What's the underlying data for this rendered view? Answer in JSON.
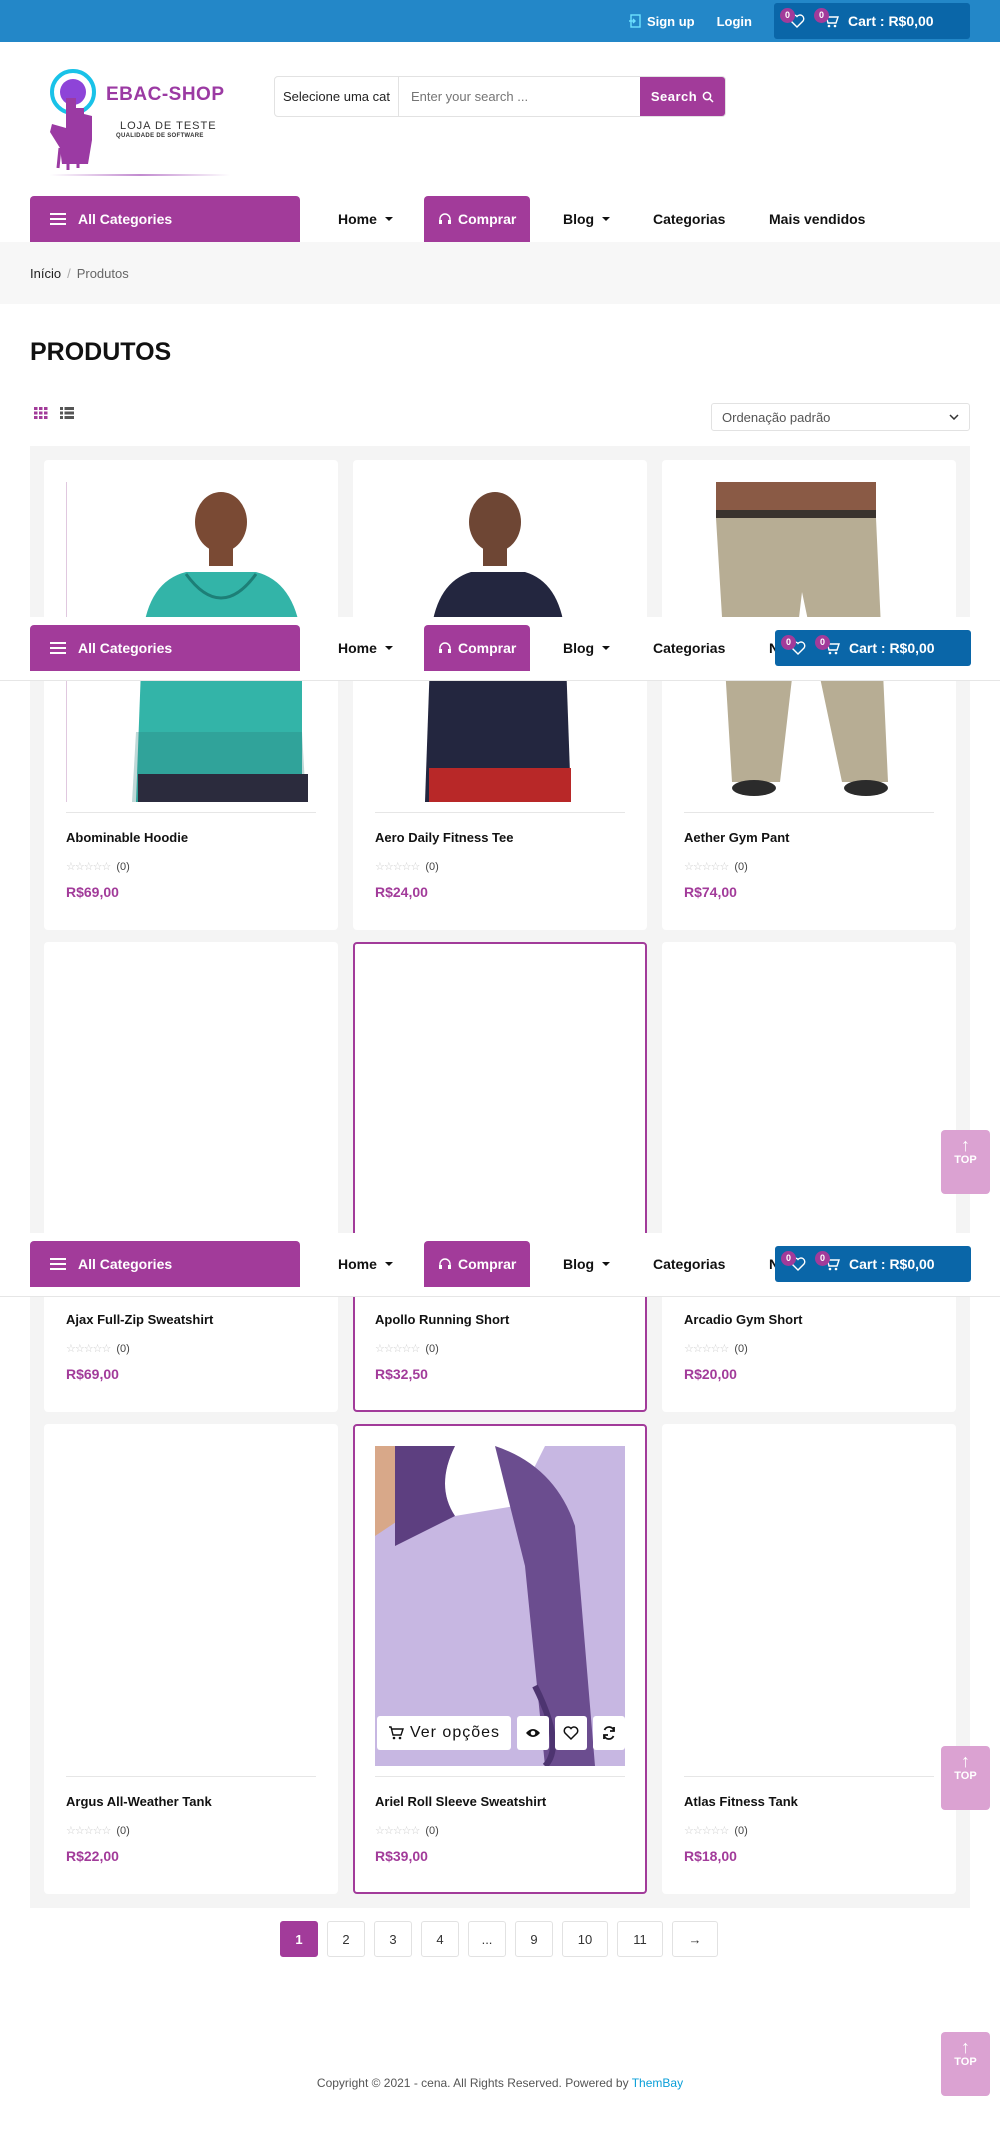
{
  "topbar": {
    "signup": "Sign up",
    "login": "Login",
    "wishlist_count": "0",
    "cart_count": "0",
    "cart_label": "Cart : R$0,00"
  },
  "logo": {
    "name": "EBAC-SHOP",
    "tagline": "LOJA DE TESTE",
    "tagline2": "QUALIDADE DE SOFTWARE"
  },
  "search": {
    "category": "Selecione uma cat",
    "placeholder": "Enter your search ...",
    "button": "Search"
  },
  "nav": {
    "all_categories": "All Categories",
    "home": "Home",
    "comprar": "Comprar",
    "blog": "Blog",
    "categorias": "Categorias",
    "mais_vendidos": "Mais vendidos",
    "mais_vendidos_short": "N"
  },
  "breadcrumb": {
    "home": "Início",
    "separator": "/",
    "current": "Produtos"
  },
  "page": {
    "title": "PRODUTOS",
    "sort": "Ordenação padrão"
  },
  "products": [
    {
      "name": "Abominable Hoodie",
      "rating_count": "(0)",
      "price": "R$69,00"
    },
    {
      "name": "Aero Daily Fitness Tee",
      "rating_count": "(0)",
      "price": "R$24,00"
    },
    {
      "name": "Aether Gym Pant",
      "rating_count": "(0)",
      "price": "R$74,00"
    },
    {
      "name": "Ajax Full-Zip Sweatshirt",
      "rating_count": "(0)",
      "price": "R$69,00"
    },
    {
      "name": "Apollo Running Short",
      "rating_count": "(0)",
      "price": "R$32,50"
    },
    {
      "name": "Arcadio Gym Short",
      "rating_count": "(0)",
      "price": "R$20,00"
    },
    {
      "name": "Argus All-Weather Tank",
      "rating_count": "(0)",
      "price": "R$22,00"
    },
    {
      "name": "Ariel Roll Sleeve Sweatshirt",
      "rating_count": "(0)",
      "price": "R$39,00"
    },
    {
      "name": "Atlas Fitness Tank",
      "rating_count": "(0)",
      "price": "R$18,00"
    }
  ],
  "product_actions": {
    "ver_opcoes": "Ver opções"
  },
  "top_button": "TOP",
  "pagination": [
    "1",
    "2",
    "3",
    "4",
    "...",
    "9",
    "10",
    "11",
    "→"
  ],
  "footer": {
    "text": "Copyright © 2021 - cena. All Rights Reserved. Powered by",
    "brand": "ThemBay"
  },
  "colors": {
    "primary": "#a23b9a",
    "topbar": "#2387c8",
    "cart": "#0a66a8",
    "top_button": "#dba2d2"
  }
}
